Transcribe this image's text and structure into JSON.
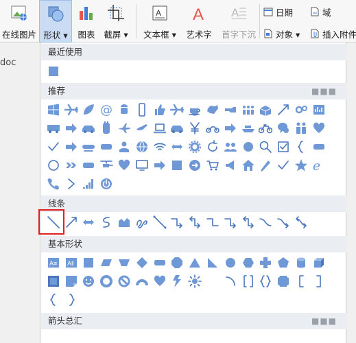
{
  "ribbon": {
    "buttons": [
      {
        "name": "online-picture-button",
        "label": "在线图片",
        "icon": "online-picture-icon"
      },
      {
        "name": "shape-button",
        "label": "形状 ▾",
        "icon": "shape-icon",
        "active": true
      },
      {
        "name": "chart-button",
        "label": "图表",
        "icon": "chart-icon"
      },
      {
        "name": "screenshot-button",
        "label": "截屏 ▾",
        "icon": "screenshot-icon"
      },
      {
        "name": "textbox-button",
        "label": "文本框 ▾",
        "icon": "textbox-icon"
      },
      {
        "name": "wordart-button",
        "label": "艺术字",
        "icon": "wordart-icon"
      },
      {
        "name": "dropcap-button",
        "label": "首字下沉",
        "icon": "dropcap-icon",
        "disabled": true
      }
    ],
    "small_buttons": [
      {
        "name": "date-button",
        "label": "日期",
        "icon": "calendar-icon"
      },
      {
        "name": "field-button",
        "label": "域",
        "icon": "field-icon"
      },
      {
        "name": "object-button",
        "label": "对象 ▾",
        "icon": "object-icon"
      },
      {
        "name": "insert-attachment-button",
        "label": "插入附件",
        "icon": "attachment-icon"
      }
    ],
    "colors": {
      "accent": "#5b8ed6",
      "active_bg": "#c9dcf3",
      "wordart": "#e8574a"
    }
  },
  "document": {
    "name_fragment": "doc"
  },
  "panel": {
    "recent": {
      "title": "最近使用",
      "icons": [
        "rectangle"
      ]
    },
    "recommended": {
      "title": "推荐",
      "rows": [
        [
          "windows-logo",
          "airplane",
          "leaf",
          "at-sign",
          "android",
          "phone",
          "thumbs-up",
          "airplane",
          "coffee",
          "china-map",
          "hand-point",
          "crowd",
          "box",
          "arrow",
          "gears",
          "reports"
        ],
        [
          "bus",
          "arrow-right",
          "car",
          "cabinet",
          "plane",
          "world-plane",
          "laptop",
          "car",
          "yen",
          "motorcycle",
          "arrow-right",
          "ship",
          "bike",
          "chat-bubble",
          "people",
          "heart"
        ],
        [
          "checkmark",
          "arrow-right",
          "train",
          "rounded-rect",
          "user",
          "globe",
          "wifi",
          "double-arrow",
          "gear",
          "refresh",
          "group",
          "circle",
          "search",
          "checkbox",
          "brace",
          "rounded-rect"
        ],
        [
          "circle-outline",
          "chevrons",
          "rounded-rect",
          "helicopter",
          "heart",
          "monitor",
          "arrow-right",
          "rectangle",
          "circle-arrow",
          "cart",
          "megaphone",
          "house",
          "pencil",
          "checkmark",
          "star",
          "internet-explorer"
        ],
        [
          "telephone",
          "chevron",
          "signal-bars",
          "power"
        ]
      ]
    },
    "lines": {
      "title": "线条",
      "icons": [
        "line",
        "arrow",
        "double-arrow",
        "curve",
        "freeform",
        "scribble",
        "elbow-connector",
        "elbow-arrow",
        "elbow-double-arrow",
        "elbow",
        "elbow-arrow",
        "elbow-double-arrow",
        "curved-connector",
        "curved-arrow",
        "curved-double-arrow"
      ]
    },
    "basic_shapes": {
      "title": "基本形状",
      "rows": [
        [
          "textbox",
          "vertical-textbox",
          "rectangle",
          "parallelogram",
          "trapezoid",
          "diamond",
          "rounded-rect",
          "octagon",
          "triangle",
          "right-triangle",
          "circle",
          "hexagon",
          "plus",
          "pentagon",
          "can",
          "cube"
        ],
        [
          "bevel",
          "folded-corner",
          "smiley",
          "donut",
          "no-symbol",
          "arc",
          "heart",
          "lightning",
          "sun",
          "moon",
          "arc-line",
          "brackets",
          "braces",
          "plaque",
          "bracket-left",
          "bracket-right"
        ],
        [
          "brace-left",
          "brace-right"
        ]
      ]
    },
    "arrows": {
      "title": "箭头总汇"
    }
  },
  "highlight": {
    "target": "line",
    "color": "#e02020"
  }
}
